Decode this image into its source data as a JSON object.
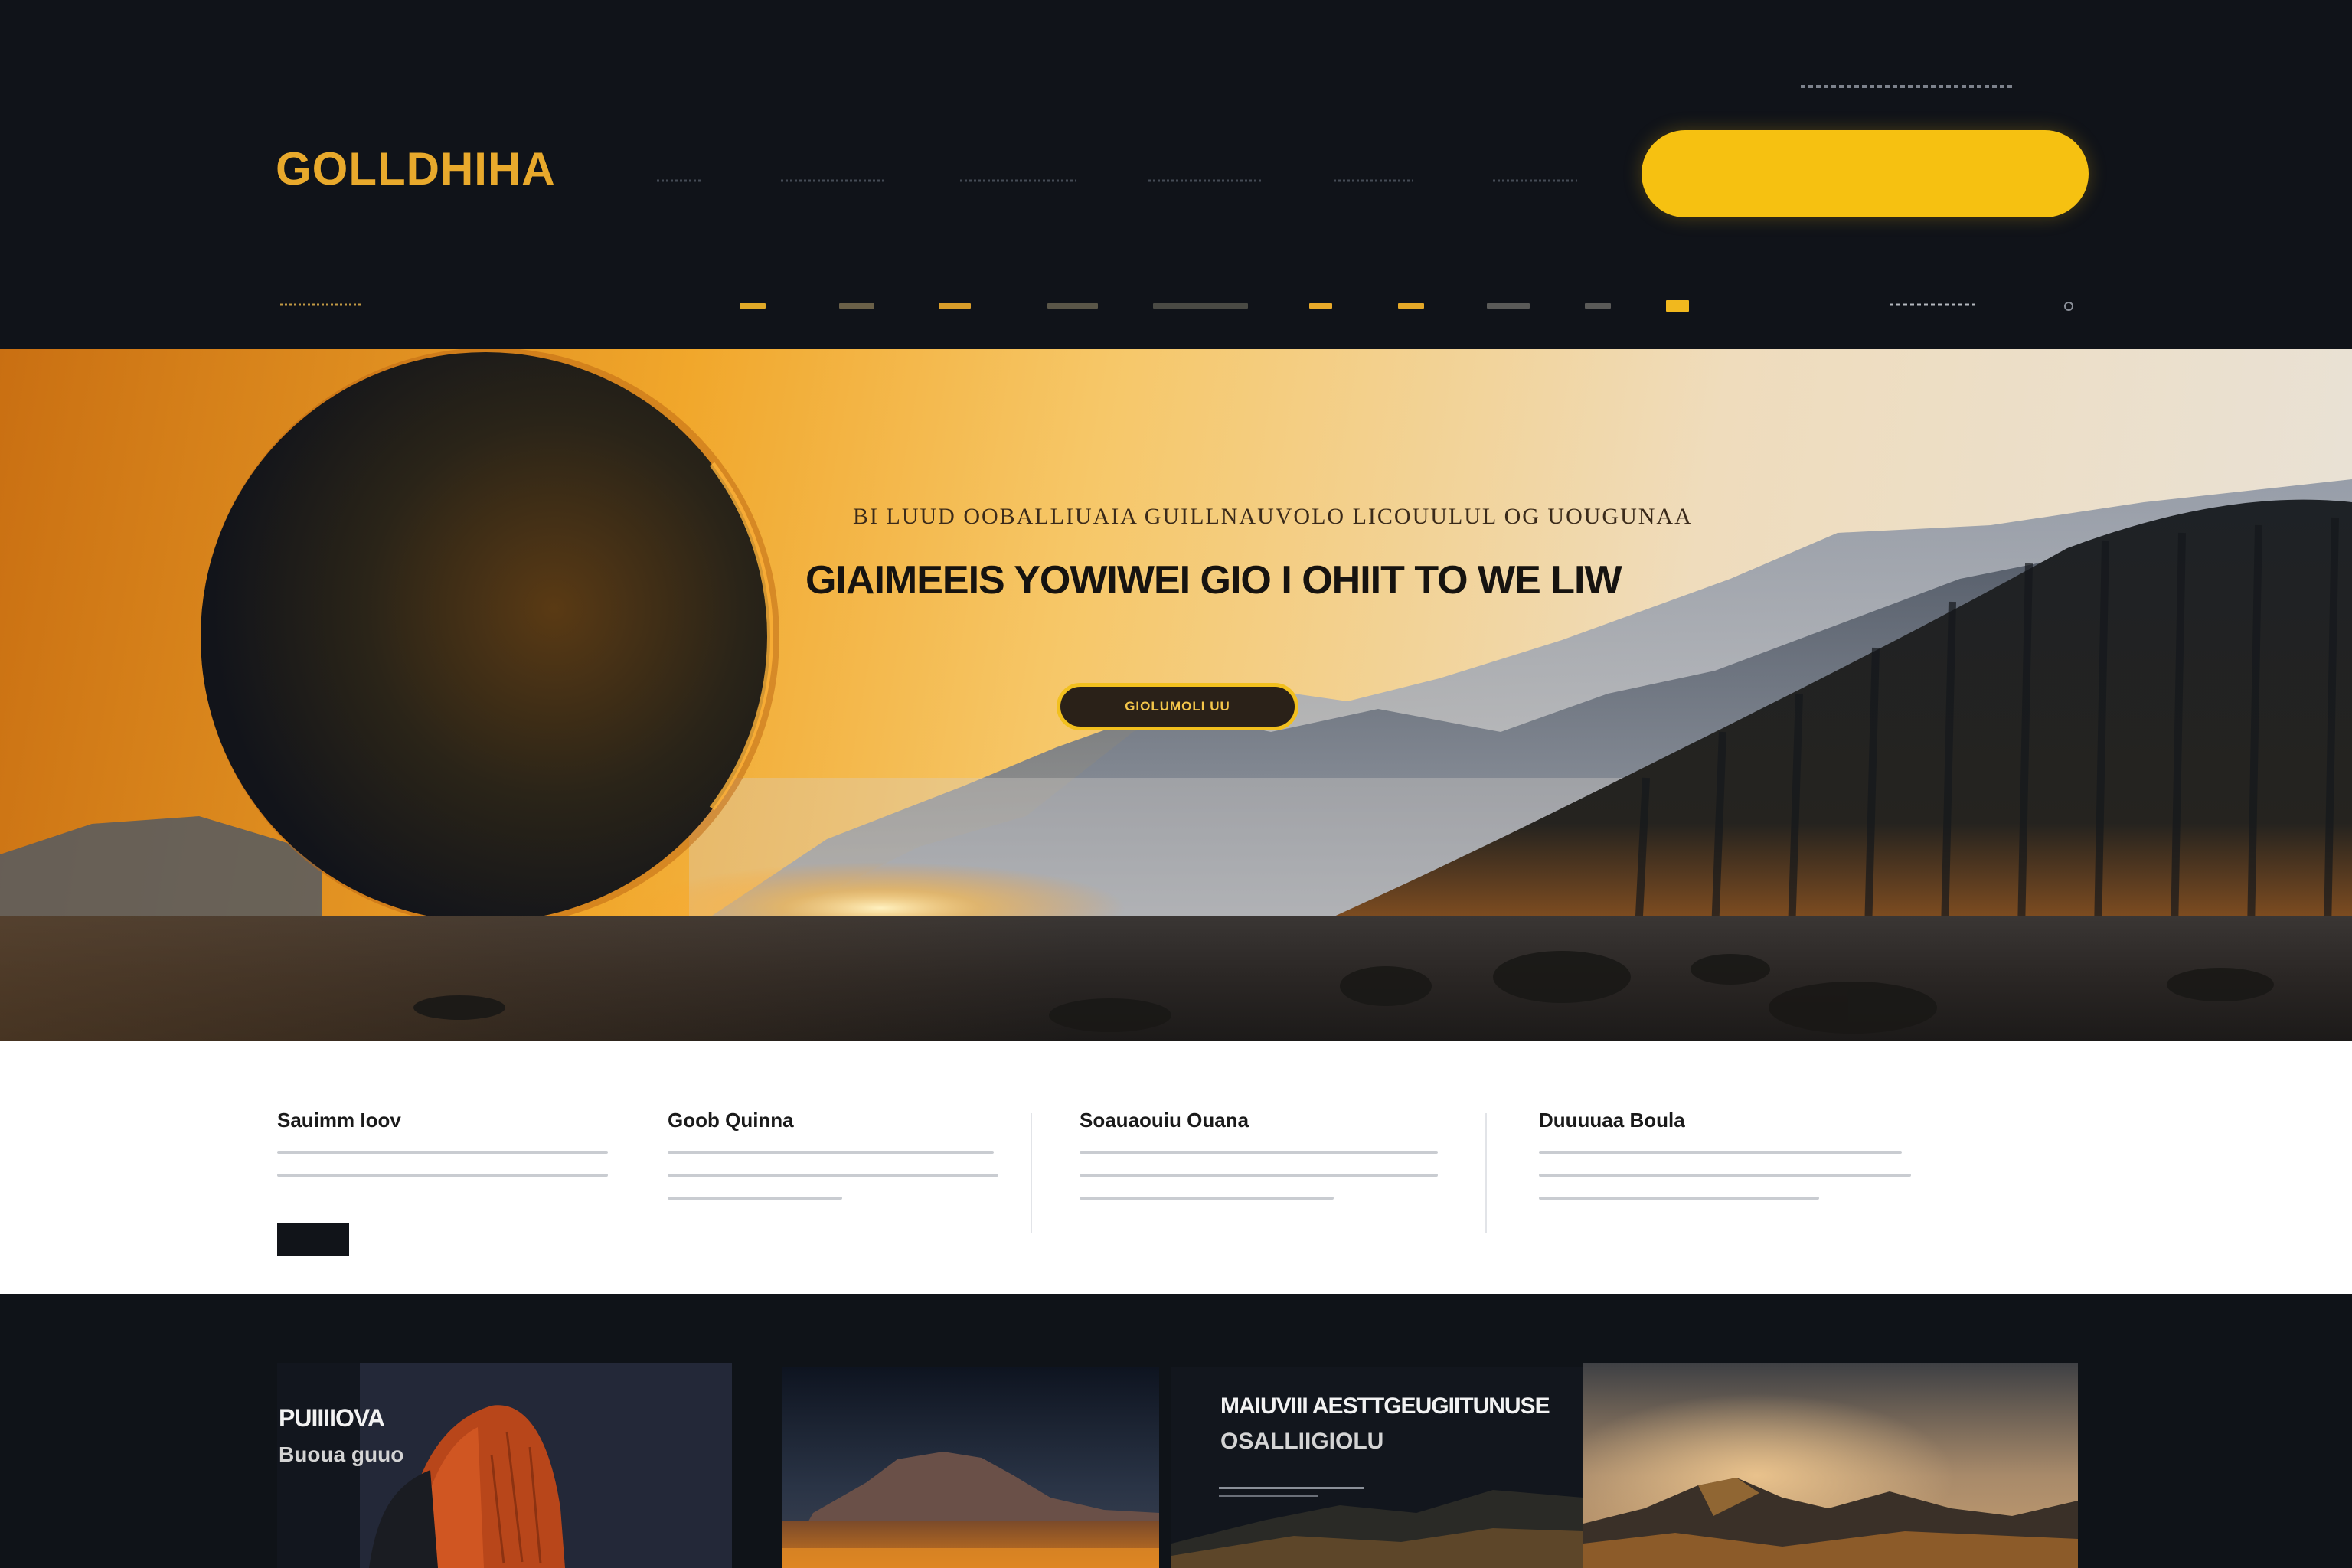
{
  "header": {
    "logo": "GOLLDHIHA",
    "cta_label": ""
  },
  "hero": {
    "eyebrow": "BI LUUD OOBALLIUAIA GUILLNAUVOLO LICOUULUL OG UOUGUNAA",
    "title": "GIAIMEEIS YOWIWEI GIO I OHIIT TO WE LIW",
    "cta_label": "GIOLUMOLI UU"
  },
  "features": [
    {
      "title": "Sauimm Ioov"
    },
    {
      "title": "Goob Quinna"
    },
    {
      "title": "Soauaouiu Ouana"
    },
    {
      "title": "Duuuuaa Boula"
    }
  ],
  "gallery": {
    "card1": {
      "title": "PUIIIIOVA",
      "subtitle": "Buoua guuo"
    },
    "card3": {
      "title": "MAIUVIII AESTTGEUGIITUNUSE",
      "subtitle": "OSALLIIGIOLU"
    }
  },
  "colors": {
    "brand_gold": "#f6c111",
    "logo_gold": "#e8a92c",
    "header_bg": "#101319",
    "features_bg": "#ffffff"
  },
  "icons": {
    "subnav_indicator": "circle-outline"
  }
}
